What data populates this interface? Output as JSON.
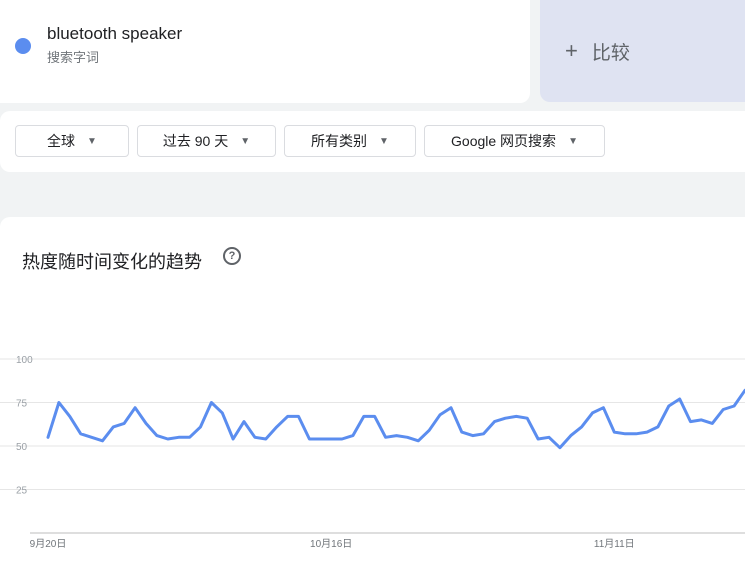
{
  "term": {
    "name": "bluetooth speaker",
    "subtitle": "搜索字词",
    "color": "#5b8def"
  },
  "compare": {
    "plus": "+",
    "label": "比较"
  },
  "filters": [
    {
      "label": "全球",
      "name": "filter-region"
    },
    {
      "label": "过去 90 天",
      "name": "filter-time-range"
    },
    {
      "label": "所有类别",
      "name": "filter-category"
    },
    {
      "label": "Google 网页搜索",
      "name": "filter-search-type"
    }
  ],
  "chart": {
    "title": "热度随时间变化的趋势",
    "help_icon": "help-circle-icon"
  },
  "chart_data": {
    "type": "line",
    "title": "",
    "xlabel": "",
    "ylabel": "",
    "ylim": [
      0,
      100
    ],
    "yticks": [
      25,
      50,
      75,
      100
    ],
    "xtick_labels": [
      {
        "label": "9月20日",
        "index": 0
      },
      {
        "label": "10月16日",
        "index": 26
      },
      {
        "label": "11月11日",
        "index": 52
      }
    ],
    "grid": true,
    "series": [
      {
        "color": "#5b8def",
        "values": [
          55,
          75,
          67,
          57,
          55,
          53,
          61,
          63,
          72,
          63,
          56,
          54,
          55,
          55,
          61,
          75,
          69,
          54,
          64,
          55,
          54,
          61,
          67,
          67,
          54,
          54,
          54,
          54,
          56,
          67,
          67,
          55,
          56,
          55,
          53,
          59,
          68,
          72,
          58,
          56,
          57,
          64,
          66,
          67,
          66,
          54,
          55,
          49,
          56,
          61,
          69,
          72,
          58,
          57,
          57,
          58,
          61,
          73,
          77,
          64,
          65,
          63,
          71,
          73,
          82
        ]
      }
    ]
  }
}
